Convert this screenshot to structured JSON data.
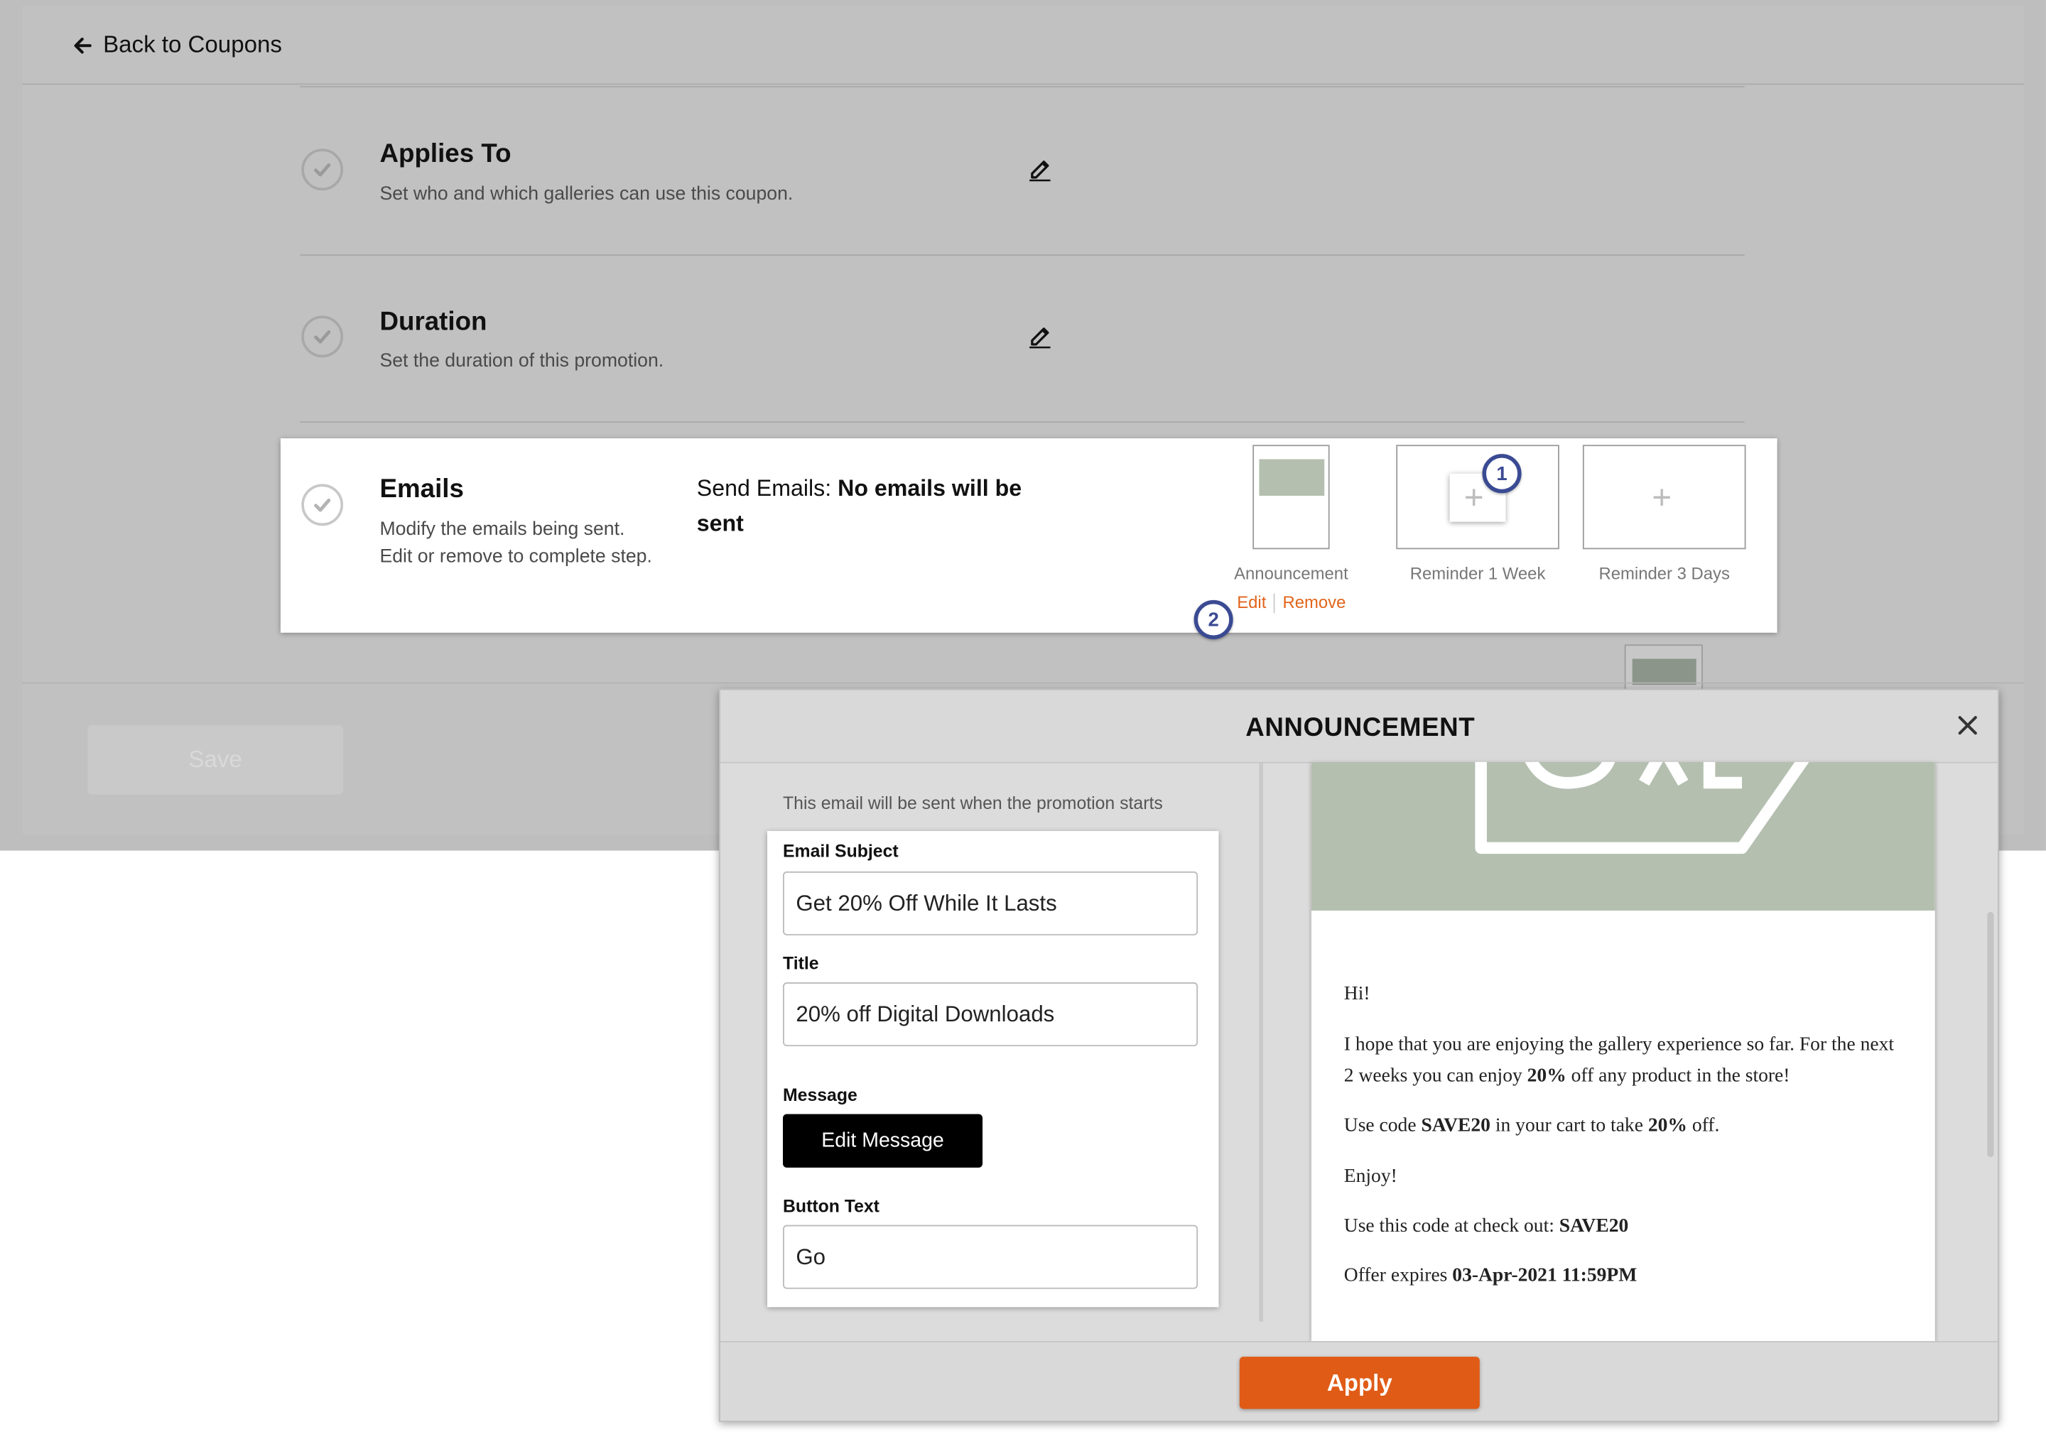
{
  "header": {
    "back_label": "Back to Coupons"
  },
  "steps": {
    "applies_to": {
      "title": "Applies To",
      "description": "Set who and which galleries can use this coupon."
    },
    "duration": {
      "title": "Duration",
      "description": "Set the duration of this promotion."
    },
    "emails": {
      "title": "Emails",
      "description": "Modify the emails being sent. Edit or remove to complete step.",
      "send_prefix": "Send Emails:",
      "send_value": "No emails will be sent",
      "thumbnails": [
        {
          "label": "Announcement"
        },
        {
          "label": "Reminder 1 Week"
        },
        {
          "label": "Reminder 3 Days"
        }
      ],
      "edit_link": "Edit",
      "remove_link": "Remove"
    }
  },
  "badges": {
    "one": "1",
    "two": "2"
  },
  "footer": {
    "save_label": "Save"
  },
  "modal": {
    "title": "ANNOUNCEMENT",
    "intro": "This email will be sent when the promotion starts",
    "subject_label": "Email Subject",
    "subject_value": "Get 20% Off While It Lasts",
    "title_label": "Title",
    "title_value": "20% off Digital Downloads",
    "message_label": "Message",
    "edit_message_button": "Edit Message",
    "button_text_label": "Button Text",
    "button_text_value": "Go",
    "apply_label": "Apply",
    "preview": {
      "greeting": "Hi!",
      "p1_a": "I hope that you are enjoying the gallery experience so far. For the next 2 weeks you can enjoy ",
      "p1_b": "20%",
      "p1_c": " off any product in the store!",
      "p2_a": "Use code ",
      "p2_b": "SAVE20",
      "p2_c": " in your cart to take ",
      "p2_d": "20%",
      "p2_e": " off.",
      "p3": "Enjoy!",
      "p4_a": "Use this code at check out: ",
      "p4_b": "SAVE20",
      "p5_a": "Offer expires ",
      "p5_b": "03-Apr-2021 11:59PM"
    }
  },
  "colors": {
    "accent": "#e05b16",
    "badge": "#3a4a93",
    "banner": "#b4bfb0",
    "overlay": "#bebebe"
  },
  "icons": [
    "arrow-left-icon",
    "check-icon",
    "pencil-icon",
    "plus-icon",
    "close-icon"
  ]
}
